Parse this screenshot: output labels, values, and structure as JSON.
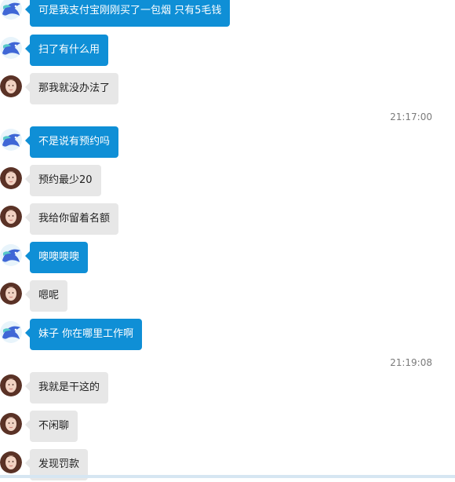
{
  "colors": {
    "sent_bubble": "#0f8fd6",
    "recv_bubble": "#e7e7e7",
    "timestamp": "#7b7b7b"
  },
  "avatars": {
    "sender": "dolphin-avatar-icon",
    "receiver": "woman-portrait-avatar"
  },
  "messages": [
    {
      "from": "sender",
      "text": "可是我支付宝刚刚买了一包烟 只有5毛钱"
    },
    {
      "from": "sender",
      "text": "扫了有什么用"
    },
    {
      "from": "receiver",
      "text": "那我就没办法了"
    },
    {
      "timestamp": "21:17:00"
    },
    {
      "from": "sender",
      "text": "不是说有预约吗"
    },
    {
      "from": "receiver",
      "text": "预约最少20"
    },
    {
      "from": "receiver",
      "text": "我给你留着名额"
    },
    {
      "from": "sender",
      "text": "噢噢噢噢"
    },
    {
      "from": "receiver",
      "text": "嗯呢"
    },
    {
      "from": "sender",
      "text": "妹子 你在哪里工作啊"
    },
    {
      "timestamp": "21:19:08"
    },
    {
      "from": "receiver",
      "text": "我就是干这的"
    },
    {
      "from": "receiver",
      "text": "不闲聊"
    },
    {
      "from": "receiver",
      "text": "发现罚款"
    }
  ]
}
